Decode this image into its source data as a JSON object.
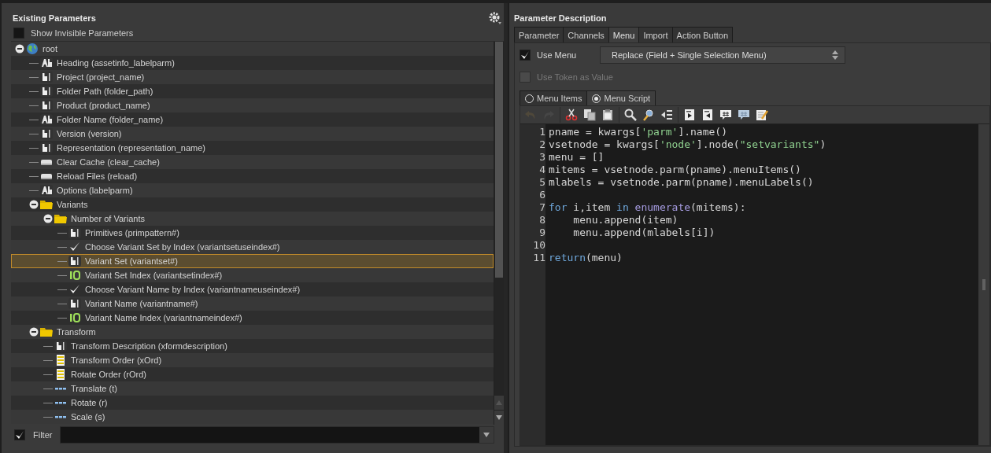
{
  "parameters_panel": {
    "title": "Existing Parameters",
    "show_invisible": {
      "label": "Show Invisible Parameters",
      "checked": false
    },
    "tree": [
      {
        "kind": "root",
        "label": "root",
        "expanded": true,
        "selected": false,
        "children": [
          {
            "kind": "label",
            "label": "Heading (assetinfo_labelparm)",
            "selected": false
          },
          {
            "kind": "string",
            "label": "Project (project_name)",
            "selected": false
          },
          {
            "kind": "string",
            "label": "Folder Path (folder_path)",
            "selected": false
          },
          {
            "kind": "string",
            "label": "Product (product_name)",
            "selected": false
          },
          {
            "kind": "label",
            "label": "Folder Name (folder_name)",
            "selected": false
          },
          {
            "kind": "string",
            "label": "Version (version)",
            "selected": false
          },
          {
            "kind": "string",
            "label": "Representation (representation_name)",
            "selected": false
          },
          {
            "kind": "button",
            "label": "Clear Cache (clear_cache)",
            "selected": false
          },
          {
            "kind": "button",
            "label": "Reload Files (reload)",
            "selected": false
          },
          {
            "kind": "label",
            "label": "Options (labelparm)",
            "selected": false
          },
          {
            "kind": "folder",
            "label": "Variants",
            "expanded": true,
            "selected": false,
            "children": [
              {
                "kind": "folder",
                "label": "Number of Variants",
                "expanded": true,
                "selected": false,
                "children": [
                  {
                    "kind": "string",
                    "label": "Primitives (primpattern#)",
                    "selected": false
                  },
                  {
                    "kind": "toggle",
                    "label": "Choose Variant Set by Index (variantsetuseindex#)",
                    "selected": false
                  },
                  {
                    "kind": "string",
                    "label": "Variant Set (variantset#)",
                    "selected": true
                  },
                  {
                    "kind": "int",
                    "label": "Variant Set Index (variantsetindex#)",
                    "selected": false
                  },
                  {
                    "kind": "toggle",
                    "label": "Choose Variant Name by Index (variantnameuseindex#)",
                    "selected": false
                  },
                  {
                    "kind": "string",
                    "label": "Variant Name (variantname#)",
                    "selected": false
                  },
                  {
                    "kind": "int",
                    "label": "Variant Name Index (variantnameindex#)",
                    "selected": false
                  }
                ]
              }
            ]
          },
          {
            "kind": "folder",
            "label": "Transform",
            "expanded": true,
            "selected": false,
            "children": [
              {
                "kind": "string",
                "label": "Transform Description (xformdescription)",
                "selected": false
              },
              {
                "kind": "menu",
                "label": "Transform Order (xOrd)",
                "selected": false
              },
              {
                "kind": "menu",
                "label": "Rotate Order (rOrd)",
                "selected": false
              },
              {
                "kind": "vector",
                "label": "Translate (t)",
                "selected": false
              },
              {
                "kind": "vector",
                "label": "Rotate (r)",
                "selected": false
              },
              {
                "kind": "vector",
                "label": "Scale (s)",
                "selected": false
              }
            ]
          }
        ]
      }
    ],
    "filter": {
      "label": "Filter",
      "checked": true
    }
  },
  "description_panel": {
    "title": "Parameter Description",
    "tabs": [
      {
        "label": "Parameter",
        "selected": false
      },
      {
        "label": "Channels",
        "selected": false
      },
      {
        "label": "Menu",
        "selected": true
      },
      {
        "label": "Import",
        "selected": false
      },
      {
        "label": "Action Button",
        "selected": false
      }
    ],
    "use_menu": {
      "label": "Use Menu",
      "checked": true
    },
    "menu_type": {
      "value": "Replace (Field + Single Selection Menu)"
    },
    "use_token": {
      "label": "Use Token as Value",
      "checked": false,
      "disabled": true
    },
    "source_options": [
      {
        "label": "Menu Items",
        "selected": false
      },
      {
        "label": "Menu Script",
        "selected": true
      }
    ],
    "toolbar": [
      {
        "kind": "undo",
        "disabled": true
      },
      {
        "kind": "redo",
        "disabled": true
      },
      {
        "kind": "cut",
        "disabled": false
      },
      {
        "kind": "copy",
        "disabled": false
      },
      {
        "kind": "paste",
        "disabled": false
      },
      {
        "kind": "search",
        "disabled": false
      },
      {
        "kind": "replace",
        "disabled": false
      },
      {
        "kind": "goto",
        "disabled": false
      },
      {
        "kind": "indent",
        "disabled": false
      },
      {
        "kind": "outdent",
        "disabled": false
      },
      {
        "kind": "comment",
        "disabled": false
      },
      {
        "kind": "uncomment",
        "disabled": false
      },
      {
        "kind": "edit",
        "disabled": false
      }
    ],
    "code": [
      {
        "number": "1",
        "tokens": [
          {
            "kind": "plain",
            "text": "pname = kwargs["
          },
          {
            "kind": "string",
            "text": "'parm'"
          },
          {
            "kind": "plain",
            "text": "].name()"
          }
        ]
      },
      {
        "number": "2",
        "tokens": [
          {
            "kind": "plain",
            "text": "vsetnode = kwargs["
          },
          {
            "kind": "string",
            "text": "'node'"
          },
          {
            "kind": "plain",
            "text": "].node("
          },
          {
            "kind": "string",
            "text": "\"setvariants\""
          },
          {
            "kind": "plain",
            "text": ")"
          }
        ]
      },
      {
        "number": "3",
        "tokens": [
          {
            "kind": "plain",
            "text": "menu = []"
          }
        ]
      },
      {
        "number": "4",
        "tokens": [
          {
            "kind": "plain",
            "text": "mitems = vsetnode.parm(pname).menuItems()"
          }
        ]
      },
      {
        "number": "5",
        "tokens": [
          {
            "kind": "plain",
            "text": "mlabels = vsetnode.parm(pname).menuLabels()"
          }
        ]
      },
      {
        "number": "6"
      },
      {
        "number": "7",
        "tokens": [
          {
            "kind": "keyword",
            "text": "for"
          },
          {
            "kind": "plain",
            "text": " i,item "
          },
          {
            "kind": "keyword",
            "text": "in"
          },
          {
            "kind": "builtin",
            "text": " enumerate"
          },
          {
            "kind": "plain",
            "text": "(mitems):"
          }
        ]
      },
      {
        "number": "8",
        "tokens": [
          {
            "kind": "plain",
            "text": "    menu.append(item)"
          }
        ]
      },
      {
        "number": "9",
        "tokens": [
          {
            "kind": "plain",
            "text": "    menu.append(mlabels[i])"
          }
        ]
      },
      {
        "number": "10"
      },
      {
        "number": "11",
        "tokens": [
          {
            "kind": "keyword",
            "text": "return"
          },
          {
            "kind": "plain",
            "text": "(menu)"
          }
        ]
      }
    ]
  }
}
